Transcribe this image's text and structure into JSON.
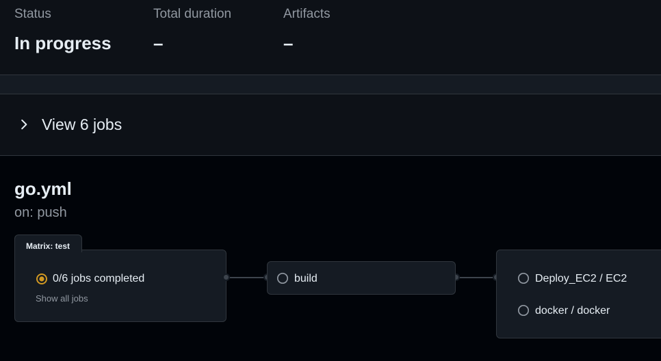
{
  "summary": {
    "status_label": "Status",
    "status_value": "In progress",
    "duration_label": "Total duration",
    "duration_value": "–",
    "artifacts_label": "Artifacts",
    "artifacts_value": "–"
  },
  "jobs_toggle": {
    "label": "View 6 jobs",
    "icon": "chevron-right-icon"
  },
  "workflow": {
    "file": "go.yml",
    "trigger": "on: push"
  },
  "graph": {
    "matrix": {
      "tab_label": "Matrix: test",
      "status_text": "0/6 jobs completed",
      "status_icon": "in-progress-icon",
      "show_all": "Show all jobs"
    },
    "build": {
      "label": "build",
      "status_icon": "queued-icon"
    },
    "deploy_jobs": [
      {
        "label": "Deploy_EC2 / EC2",
        "status_icon": "queued-icon"
      },
      {
        "label": "docker / docker",
        "status_icon": "queued-icon"
      }
    ]
  },
  "colors": {
    "page_bg": "#010409",
    "panel_bg": "#0d1117",
    "card_bg": "#151b23",
    "border": "#30363d",
    "muted_text": "#9198a1",
    "in_progress": "#d29922"
  }
}
